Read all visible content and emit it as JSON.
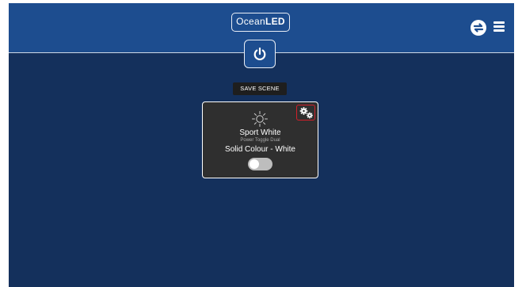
{
  "header": {
    "logo": {
      "part1": "Ocean",
      "part2": "LED"
    },
    "sync_icon": "sync-arrows-icon",
    "menu_icon": "hamburger-menu-icon"
  },
  "power_button": {
    "icon": "power-icon"
  },
  "save_scene": {
    "label": "SAVE SCENE"
  },
  "light_card": {
    "icon": "sun-icon",
    "settings_icon": "gears-icon",
    "name": "Sport White",
    "type": "Power Toggle Dual",
    "mode": "Solid Colour - White",
    "toggle_on": false
  },
  "colors": {
    "header_bg": "#1d4d8f",
    "body_bg": "#14305c",
    "card_bg": "#2f2f2f",
    "settings_highlight": "#d11f2a"
  }
}
